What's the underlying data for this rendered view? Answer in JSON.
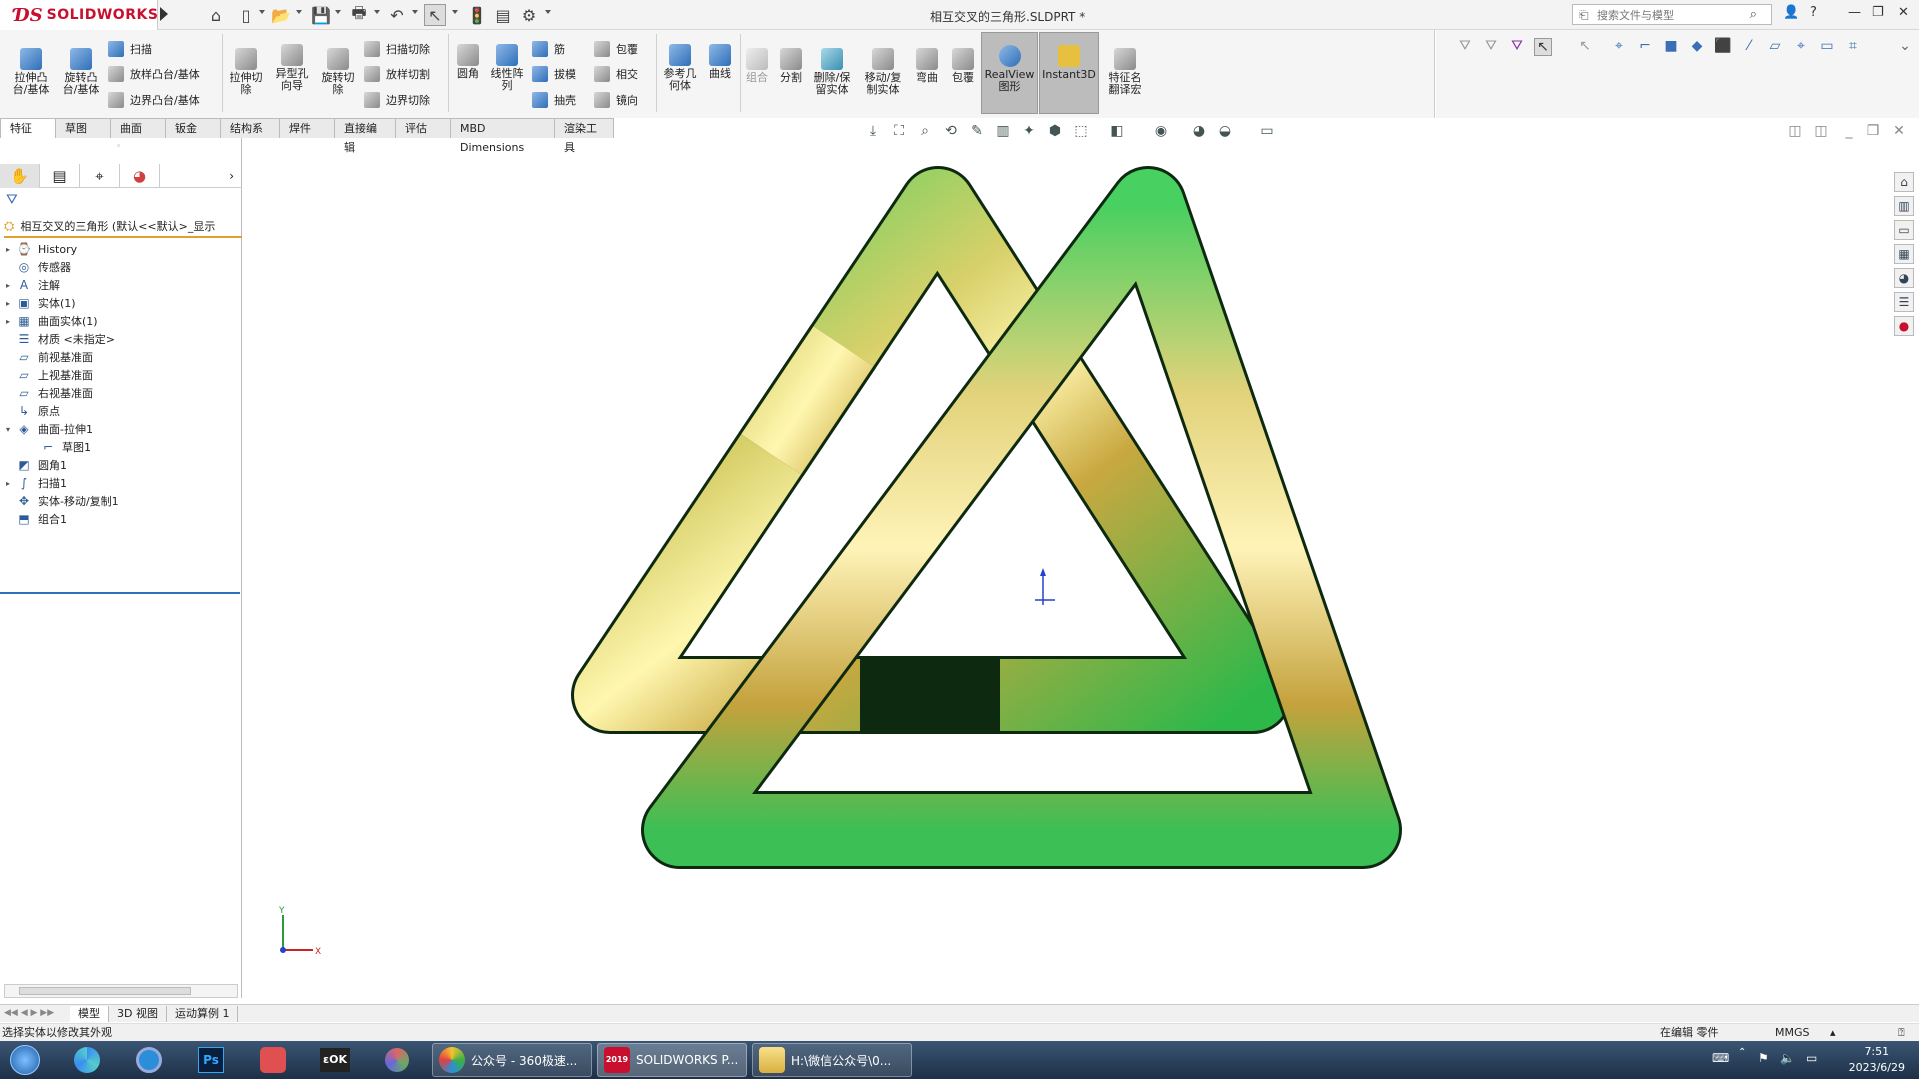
{
  "app": {
    "brand": "SOLIDWORKS",
    "document_title": "相互交叉的三角形.SLDPRT *",
    "search_placeholder": "搜索文件与模型"
  },
  "commands": {
    "extrude_boss": "拉伸凸\n台/基体",
    "revolve_boss": "旋转凸\n台/基体",
    "sweep": "扫描",
    "loft_boss": "放样凸台/基体",
    "boundary_boss": "边界凸台/基体",
    "extrude_cut": "拉伸切\n除",
    "hole_wizard": "异型孔\n向导",
    "revolve_cut": "旋转切\n除",
    "sweep_cut": "扫描切除",
    "loft_cut": "放样切割",
    "boundary_cut": "边界切除",
    "fillet": "圆角",
    "linear_pattern": "线性阵\n列",
    "rib": "筋",
    "draft": "拔模",
    "shell": "抽壳",
    "wrap": "包覆",
    "intersect": "相交",
    "mirror": "镜向",
    "ref_geometry": "参考几\n何体",
    "curves": "曲线",
    "combine": "组合",
    "split": "分割",
    "delete_keep_body": "删除/保\n留实体",
    "move_copy_body": "移动/复\n制实体",
    "flex": "弯曲",
    "wrap2": "包覆",
    "realview": "RealView\n图形",
    "instant3d": "Instant3D",
    "feature_translate": "特征名\n翻译宏"
  },
  "tabs": [
    "特征",
    "草图",
    "曲面",
    "钣金",
    "结构系统",
    "焊件",
    "直接编辑",
    "评估",
    "MBD Dimensions",
    "渲染工具"
  ],
  "tree": {
    "root": "相互交叉的三角形  (默认<<默认>_显示",
    "items": [
      {
        "label": "History",
        "expand": "▸"
      },
      {
        "label": "传感器",
        "expand": ""
      },
      {
        "label": "注解",
        "expand": "▸"
      },
      {
        "label": "实体(1)",
        "expand": "▸"
      },
      {
        "label": "曲面实体(1)",
        "expand": "▸"
      },
      {
        "label": "材质 <未指定>",
        "expand": ""
      },
      {
        "label": "前视基准面",
        "expand": ""
      },
      {
        "label": "上视基准面",
        "expand": ""
      },
      {
        "label": "右视基准面",
        "expand": ""
      },
      {
        "label": "原点",
        "expand": ""
      },
      {
        "label": "曲面-拉伸1",
        "expand": "▾"
      },
      {
        "label": "草图1",
        "expand": ""
      },
      {
        "label": "圆角1",
        "expand": ""
      },
      {
        "label": "扫描1",
        "expand": "▸"
      },
      {
        "label": "实体-移动/复制1",
        "expand": ""
      },
      {
        "label": "组合1",
        "expand": ""
      }
    ]
  },
  "bottom_tabs": [
    "模型",
    "3D 视图",
    "运动算例 1"
  ],
  "status": {
    "message": "选择实体以修改其外观",
    "mode": "在编辑 零件",
    "units": "MMGS"
  },
  "taskbar": {
    "btn1": "公众号 - 360极速...",
    "btn2": "SOLIDWORKS P...",
    "btn3": "H:\\微信公众号\\0...",
    "sw_year": "2019",
    "time": "7:51",
    "date": "2023/6/29"
  },
  "triad": {
    "x": "X",
    "y": "Y"
  },
  "colors": {
    "accent": "#2e6fb7",
    "brand": "#c8102e",
    "tree_root_underline": "#e0a030"
  }
}
